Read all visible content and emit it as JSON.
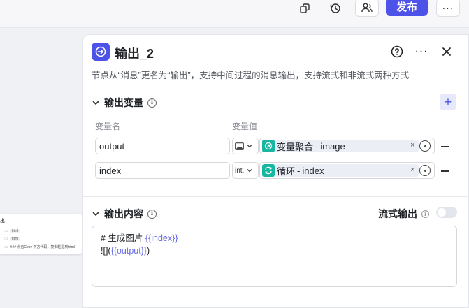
{
  "topbar": {
    "publish_label": "发布",
    "icons": [
      "copy-icon",
      "history-icon",
      "collaborator-icon",
      "more-icon"
    ]
  },
  "canvas_node": {
    "title": "出",
    "row1_tag": "html",
    "row2_tag": "html",
    "row3_text": "### 点击Copy 下方代码，复制粘贴到html"
  },
  "panel": {
    "title": "输出_2",
    "description": "节点从“消息”更名为“输出”，支持中间过程的消息输出，支持流式和非流式两种方式",
    "output_vars": {
      "section_title": "输出变量",
      "col_name": "变量名",
      "col_value": "变量值",
      "rows": [
        {
          "name": "output",
          "type": "image",
          "type_label": "",
          "ref_node": "变量聚合",
          "ref_sep": "-",
          "ref_var": "image"
        },
        {
          "name": "index",
          "type": "int",
          "type_label": "int.",
          "ref_node": "循环",
          "ref_sep": "-",
          "ref_var": "index"
        }
      ]
    },
    "output_content": {
      "section_title": "输出内容",
      "stream_label": "流式输出",
      "stream_enabled": false,
      "line1_text": "# 生成图片 ",
      "line1_var": "{{index}}",
      "line2_text": "![](",
      "line2_var": "{{output}}",
      "line2_end": ")"
    }
  },
  "colors": {
    "accent": "#4d53e8",
    "ref_icon": "#17b6a0"
  }
}
